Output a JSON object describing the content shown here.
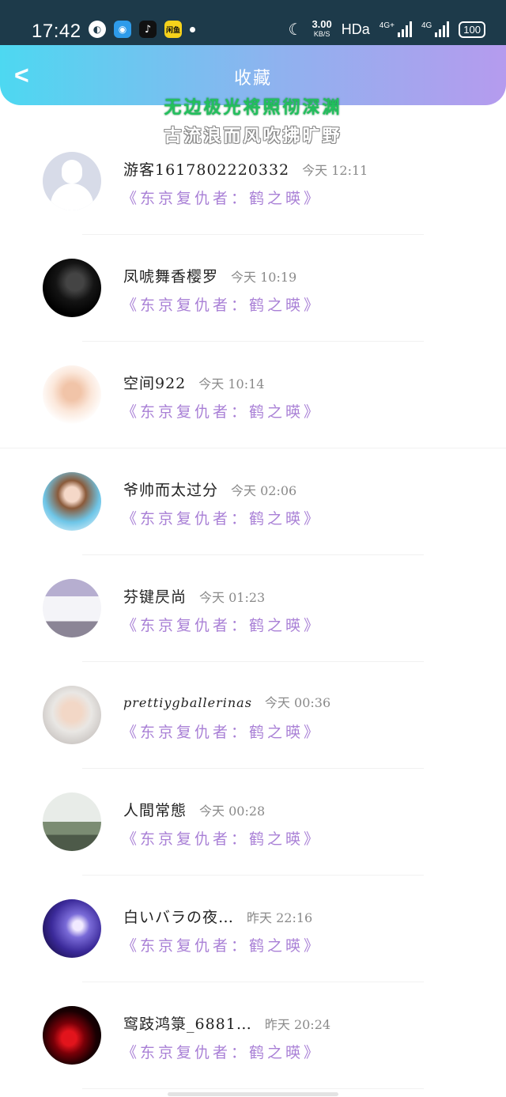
{
  "status_bar": {
    "time": "17:42",
    "icons_left": [
      "globe-icon",
      "app-circle-icon",
      "tiktok-icon",
      "app-yellow-icon"
    ],
    "yellow_app_label": "闲鱼",
    "speed_value": "3.00",
    "speed_unit": "KB/S",
    "hd_label": "HDa",
    "signal1_label": "4G+",
    "signal2_label": "4G",
    "battery": "100"
  },
  "header": {
    "title": "收藏",
    "gradient_start": "#4dd8f1",
    "gradient_end": "#b59bee"
  },
  "overlay_text": {
    "line1": "无边极光将照彻深渊",
    "line2": "古流浪而风吹拂旷野"
  },
  "list": [
    {
      "avatar": "default-user-avatar",
      "name": "游客1617802220332",
      "time": "今天 12:11",
      "work": "《东京复仇者：鹤之暎》"
    },
    {
      "avatar": "dark-character-avatar",
      "name": "凤唬舞香樱罗",
      "time": "今天 10:19",
      "work": "《东京复仇者：鹤之暎》"
    },
    {
      "avatar": "sketch-character-avatar",
      "name": "空间922",
      "time": "今天 10:14",
      "work": "《东京复仇者：鹤之暎》"
    },
    {
      "avatar": "anime-boy-avatar",
      "name": "爷帅而太过分",
      "time": "今天 02:06",
      "work": "《东京复仇者：鹤之暎》"
    },
    {
      "avatar": "car-avatar",
      "name": "芬键昃尚",
      "time": "今天 01:23",
      "work": "《东京复仇者：鹤之暎》"
    },
    {
      "avatar": "child-photo-avatar",
      "name": "prettiygballerinas",
      "time": "今天 00:36",
      "work": "《东京复仇者：鹤之暎》"
    },
    {
      "avatar": "street-photo-avatar",
      "name": "人間常態",
      "time": "今天 00:28",
      "work": "《东京复仇者：鹤之暎》"
    },
    {
      "avatar": "purple-anime-avatar",
      "name": "白いバラの夜…",
      "time": "昨天 22:16",
      "work": "《东京复仇者：鹤之暎》"
    },
    {
      "avatar": "red-flower-avatar",
      "name": "窎跂鸿箓_6881…",
      "time": "昨天 20:24",
      "work": "《东京复仇者：鹤之暎》"
    }
  ]
}
